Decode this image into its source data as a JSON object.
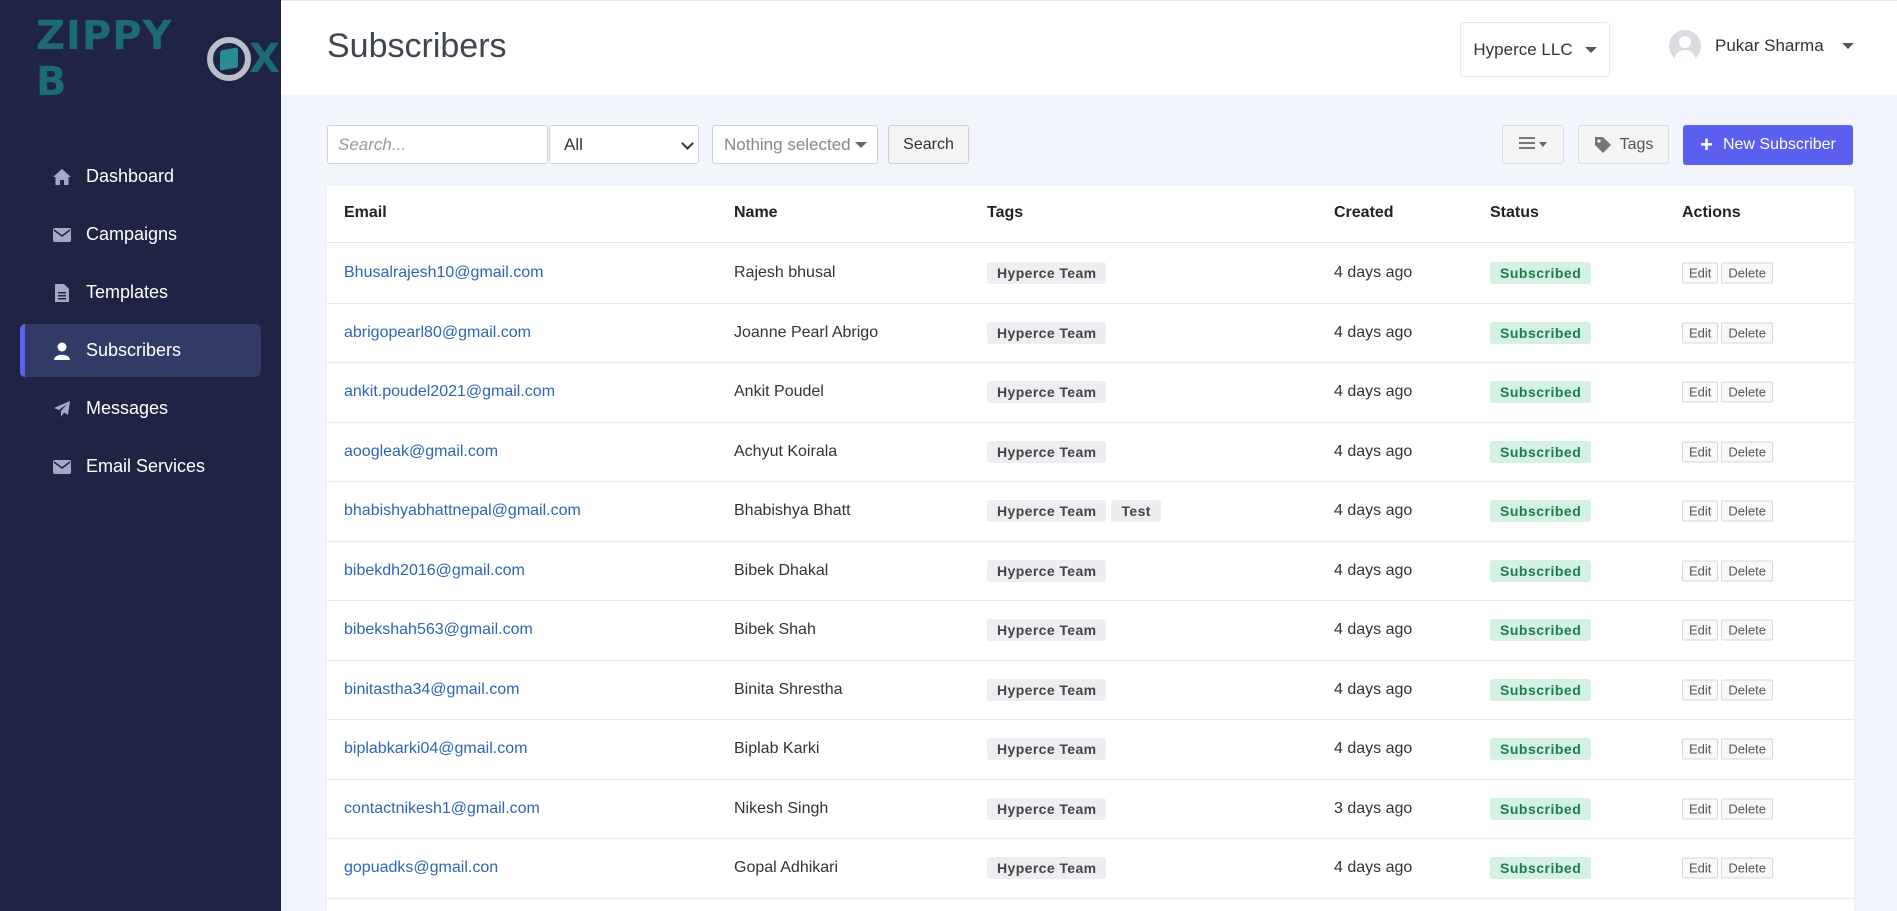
{
  "brand": {
    "logo_left": "ZIPPY B",
    "logo_right": "X"
  },
  "sidebar": {
    "items": [
      {
        "label": "Dashboard",
        "icon": "home-icon"
      },
      {
        "label": "Campaigns",
        "icon": "envelope-icon"
      },
      {
        "label": "Templates",
        "icon": "file-icon"
      },
      {
        "label": "Subscribers",
        "icon": "user-icon",
        "active": true
      },
      {
        "label": "Messages",
        "icon": "paper-plane-icon"
      },
      {
        "label": "Email Services",
        "icon": "envelope-icon"
      }
    ]
  },
  "header": {
    "title": "Subscribers",
    "company": "Hyperce LLC",
    "user": "Pukar Sharma"
  },
  "toolbar": {
    "search_placeholder": "Search...",
    "filter_value": "All",
    "tags_select_placeholder": "Nothing selected",
    "search_button": "Search",
    "tags_button": "Tags",
    "new_button": "New Subscriber"
  },
  "table": {
    "columns": [
      "Email",
      "Name",
      "Tags",
      "Created",
      "Status",
      "Actions"
    ],
    "edit_label": "Edit",
    "delete_label": "Delete",
    "rows": [
      {
        "email": "Bhusalrajesh10@gmail.com",
        "name": "Rajesh bhusal",
        "tags": [
          "Hyperce Team"
        ],
        "created": "4 days ago",
        "status": "Subscribed"
      },
      {
        "email": "abrigopearl80@gmail.com",
        "name": "Joanne Pearl Abrigo",
        "tags": [
          "Hyperce Team"
        ],
        "created": "4 days ago",
        "status": "Subscribed"
      },
      {
        "email": "ankit.poudel2021@gmail.com",
        "name": "Ankit Poudel",
        "tags": [
          "Hyperce Team"
        ],
        "created": "4 days ago",
        "status": "Subscribed"
      },
      {
        "email": "aoogleak@gmail.com",
        "name": "Achyut Koirala",
        "tags": [
          "Hyperce Team"
        ],
        "created": "4 days ago",
        "status": "Subscribed"
      },
      {
        "email": "bhabishyabhattnepal@gmail.com",
        "name": "Bhabishya Bhatt",
        "tags": [
          "Hyperce Team",
          "Test"
        ],
        "created": "4 days ago",
        "status": "Subscribed"
      },
      {
        "email": "bibekdh2016@gmail.com",
        "name": "Bibek Dhakal",
        "tags": [
          "Hyperce Team"
        ],
        "created": "4 days ago",
        "status": "Subscribed"
      },
      {
        "email": "bibekshah563@gmail.com",
        "name": "Bibek Shah",
        "tags": [
          "Hyperce Team"
        ],
        "created": "4 days ago",
        "status": "Subscribed"
      },
      {
        "email": "binitastha34@gmail.com",
        "name": "Binita Shrestha",
        "tags": [
          "Hyperce Team"
        ],
        "created": "4 days ago",
        "status": "Subscribed"
      },
      {
        "email": "biplabkarki04@gmail.com",
        "name": "Biplab Karki",
        "tags": [
          "Hyperce Team"
        ],
        "created": "4 days ago",
        "status": "Subscribed"
      },
      {
        "email": "contactnikesh1@gmail.com",
        "name": "Nikesh Singh",
        "tags": [
          "Hyperce Team"
        ],
        "created": "3 days ago",
        "status": "Subscribed"
      },
      {
        "email": "gopuadks@gmail.con",
        "name": "Gopal Adhikari",
        "tags": [
          "Hyperce Team"
        ],
        "created": "4 days ago",
        "status": "Subscribed"
      }
    ]
  }
}
